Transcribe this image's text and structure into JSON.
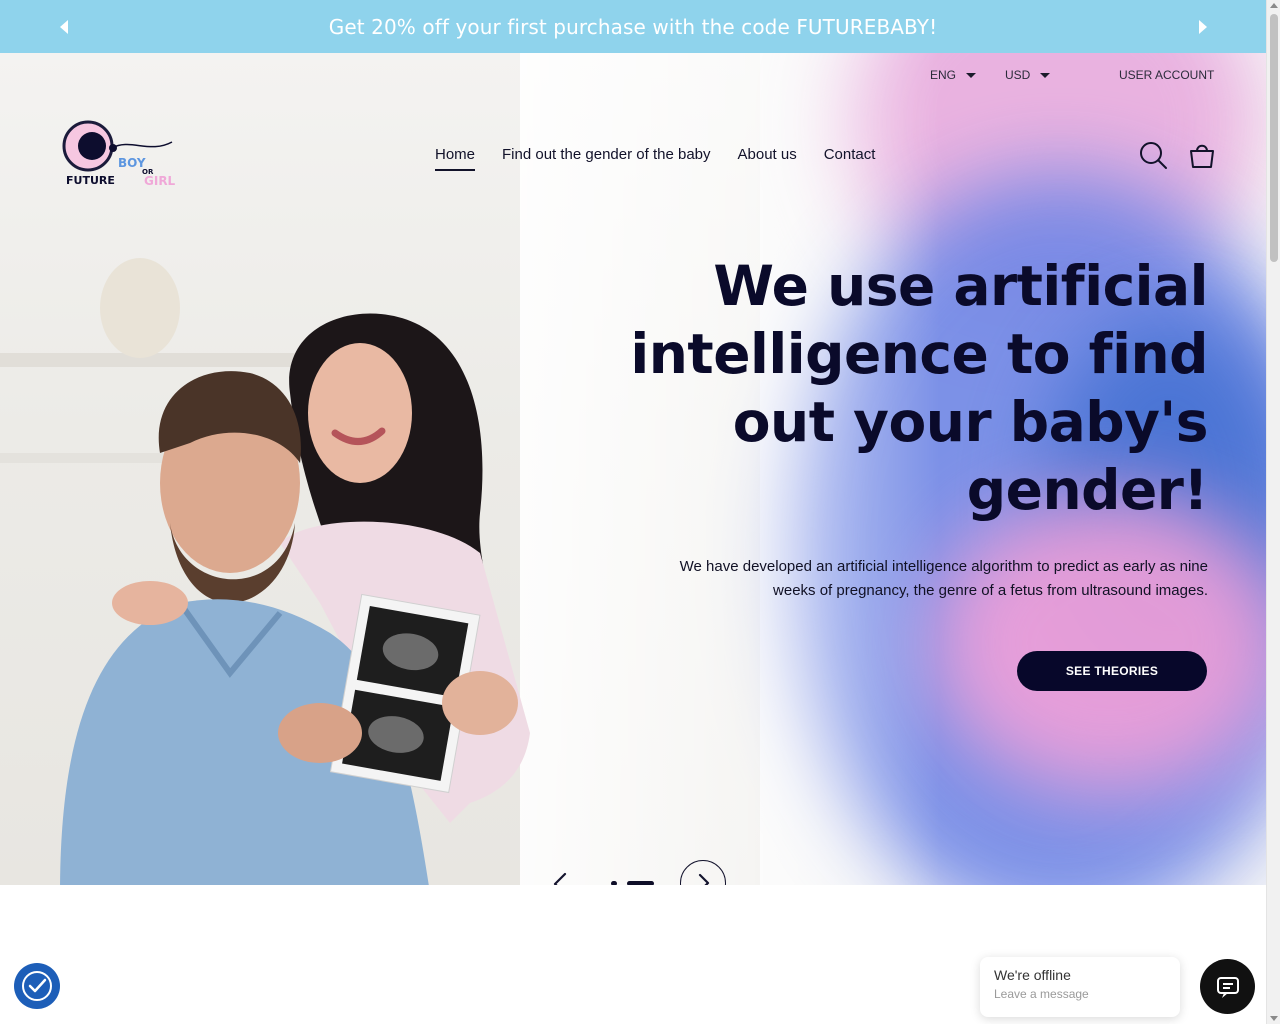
{
  "announcement": {
    "text": "Get 20% off your first purchase with the code FUTUREBABY!",
    "prev_icon": "triangle-left-icon",
    "next_icon": "triangle-right-icon",
    "background": "#8fd3ec"
  },
  "utility": {
    "language": "ENG",
    "currency": "USD",
    "account": "USER ACCOUNT"
  },
  "logo": {
    "word1": "FUTURE",
    "word2": "BOY",
    "word3": "OR",
    "word4": "GIRL"
  },
  "nav": {
    "items": [
      {
        "label": "Home",
        "active": true
      },
      {
        "label": "Find out the gender of the baby",
        "active": false
      },
      {
        "label": "About us",
        "active": false
      },
      {
        "label": "Contact",
        "active": false
      }
    ],
    "search_icon": "search-icon",
    "cart_icon": "shopping-bag-icon"
  },
  "hero": {
    "headline_line1": "We use artificial",
    "headline_line2": "intelligence to find",
    "headline_line3": "out your baby's",
    "headline_line4": "gender!",
    "subtext_line1": "We have developed an artificial intelligence algorithm to predict as early as nine",
    "subtext_line2": "weeks of pregnancy, the genre of a fetus from ultrasound images.",
    "cta": "SEE THEORIES",
    "slide_count": 2,
    "active_slide": 2
  },
  "chat": {
    "status": "We're offline",
    "prompt": "Leave a message"
  },
  "colors": {
    "navy": "#07072a",
    "accent_blue": "#1d5eb8",
    "pink": "#f2a0d8"
  }
}
